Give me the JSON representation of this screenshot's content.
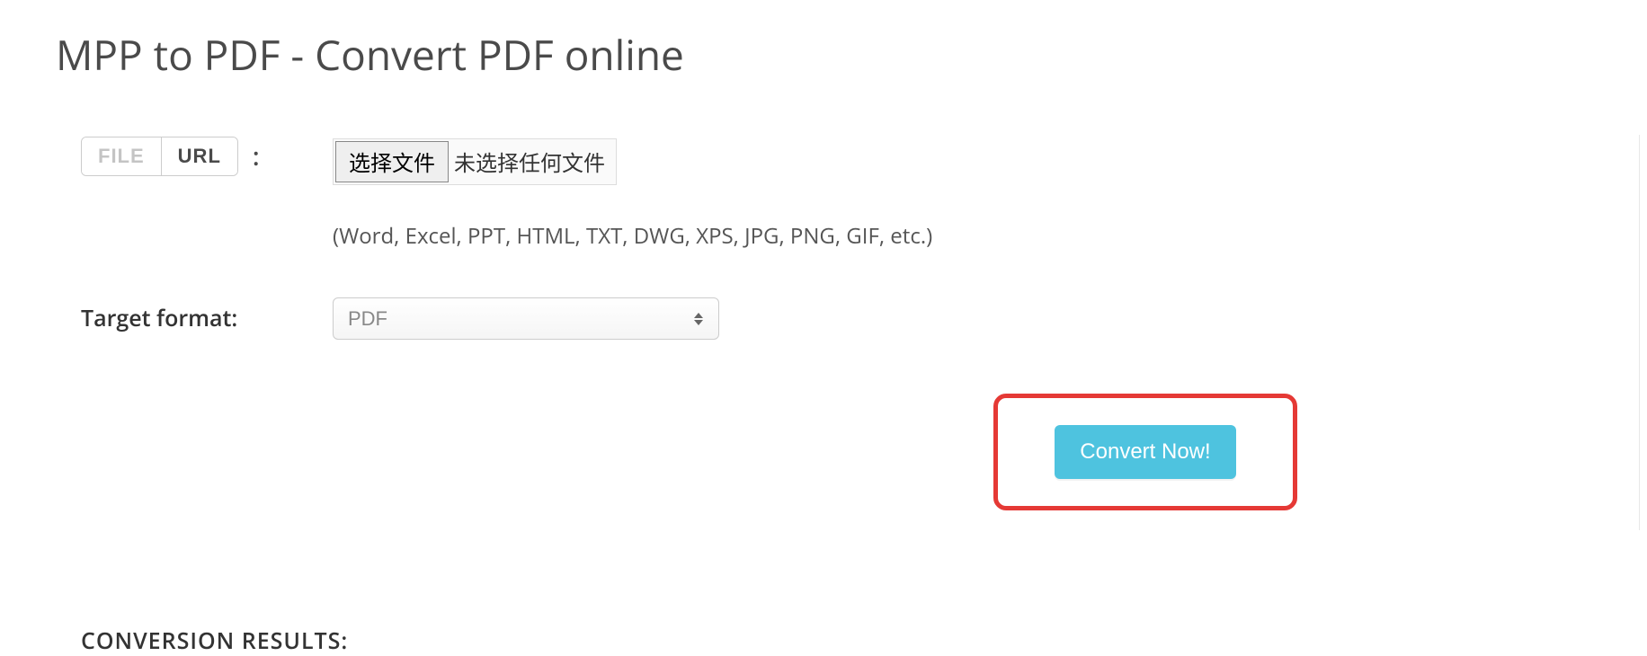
{
  "page_title": "MPP to PDF - Convert PDF online",
  "source_toggle": {
    "file_label": "FILE",
    "url_label": "URL",
    "active": "URL"
  },
  "colon": ":",
  "file_input": {
    "choose_button": "选择文件",
    "no_file_text": "未选择任何文件"
  },
  "hint": "(Word, Excel, PPT, HTML, TXT, DWG, XPS, JPG, PNG, GIF, etc.)",
  "target_format": {
    "label": "Target format:",
    "selected": "PDF"
  },
  "convert_button": "Convert Now!",
  "results_heading": "CONVERSION RESULTS:"
}
